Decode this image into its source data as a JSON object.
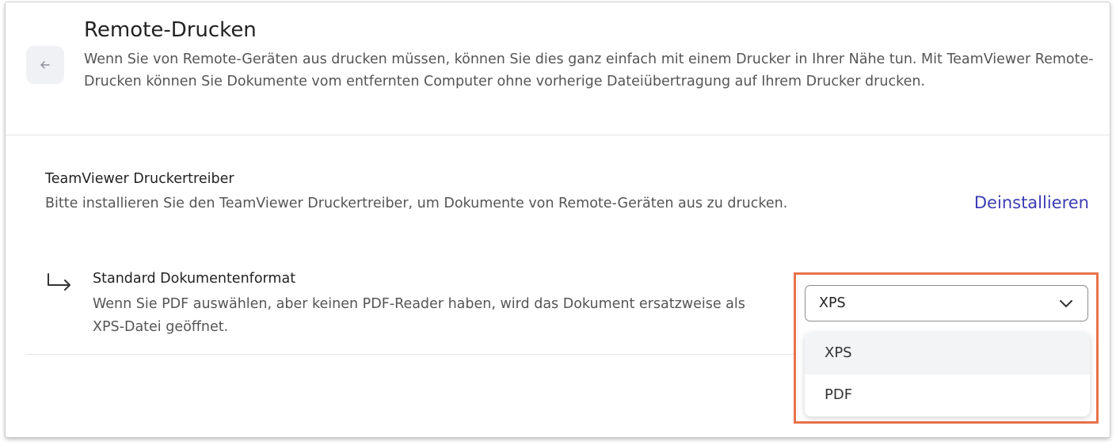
{
  "header": {
    "title": "Remote-Drucken",
    "description": "Wenn Sie von Remote-Geräten aus drucken müssen, können Sie dies ganz einfach mit einem Drucker in Ihrer Nähe tun. Mit TeamViewer Remote-Drucken können Sie Dokumente vom entfernten Computer ohne vorherige Dateiübertragung auf Ihrem Drucker drucken.",
    "back_icon": "arrow-left-icon"
  },
  "driver": {
    "title": "TeamViewer Druckertreiber",
    "description": "Bitte installieren Sie den TeamViewer Druckertreiber, um Dokumente von Remote-Geräten aus zu drucken.",
    "action_label": "Deinstallieren"
  },
  "format": {
    "title": "Standard Dokumentenformat",
    "description": "Wenn Sie PDF auswählen, aber keinen PDF-Reader haben, wird das Dokument ersatzweise als XPS-Datei geöffnet.",
    "icon": "subdirectory-arrow-icon",
    "selected_value": "XPS",
    "options": [
      "XPS",
      "PDF"
    ]
  },
  "colors": {
    "link": "#3c3cb4",
    "highlight": "#e8734a",
    "back_button_bg": "#f0f1f5"
  }
}
